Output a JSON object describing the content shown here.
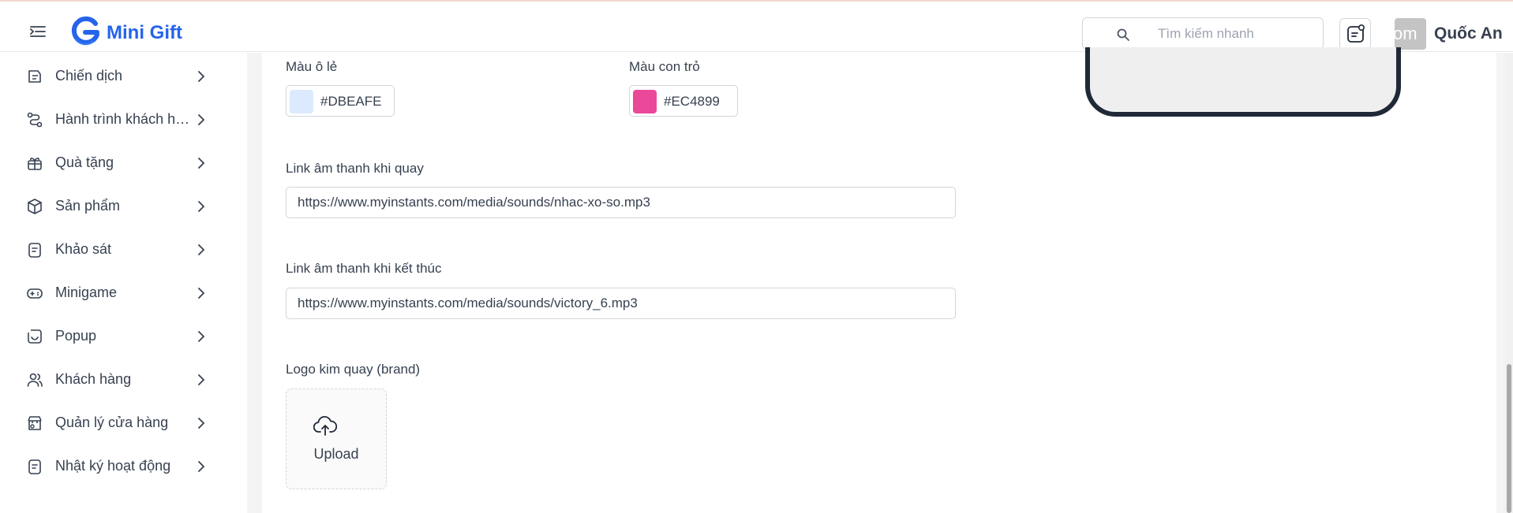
{
  "header": {
    "brand": "Mini Gift",
    "search_placeholder": "Tìm kiếm nhanh",
    "avatar_text": "om",
    "username": "Quốc An"
  },
  "sidebar": {
    "items": [
      {
        "label": "Chiến dịch",
        "icon": "campaign-icon"
      },
      {
        "label": "Hành trình khách hàng",
        "icon": "journey-icon"
      },
      {
        "label": "Quà tặng",
        "icon": "gift-icon"
      },
      {
        "label": "Sản phẩm",
        "icon": "box-icon"
      },
      {
        "label": "Khảo sát",
        "icon": "survey-icon"
      },
      {
        "label": "Minigame",
        "icon": "gamepad-icon"
      },
      {
        "label": "Popup",
        "icon": "popup-icon"
      },
      {
        "label": "Khách hàng",
        "icon": "users-icon"
      },
      {
        "label": "Quản lý cửa hàng",
        "icon": "store-icon"
      },
      {
        "label": "Nhật ký hoạt động",
        "icon": "log-icon"
      }
    ]
  },
  "form": {
    "odd_cell_color": {
      "label": "Màu ô lẻ",
      "value": "#DBEAFE"
    },
    "pointer_color": {
      "label": "Màu con trỏ",
      "value": "#EC4899"
    },
    "spin_sound": {
      "label": "Link âm thanh khi quay",
      "value": "https://www.myinstants.com/media/sounds/nhac-xo-so.mp3"
    },
    "end_sound": {
      "label": "Link âm thanh khi kết thúc",
      "value": "https://www.myinstants.com/media/sounds/victory_6.mp3"
    },
    "logo": {
      "label": "Logo kim quay (brand)",
      "upload_label": "Upload"
    }
  },
  "colors": {
    "brand": "#2563eb",
    "odd_cell": "#DBEAFE",
    "pointer": "#EC4899"
  }
}
